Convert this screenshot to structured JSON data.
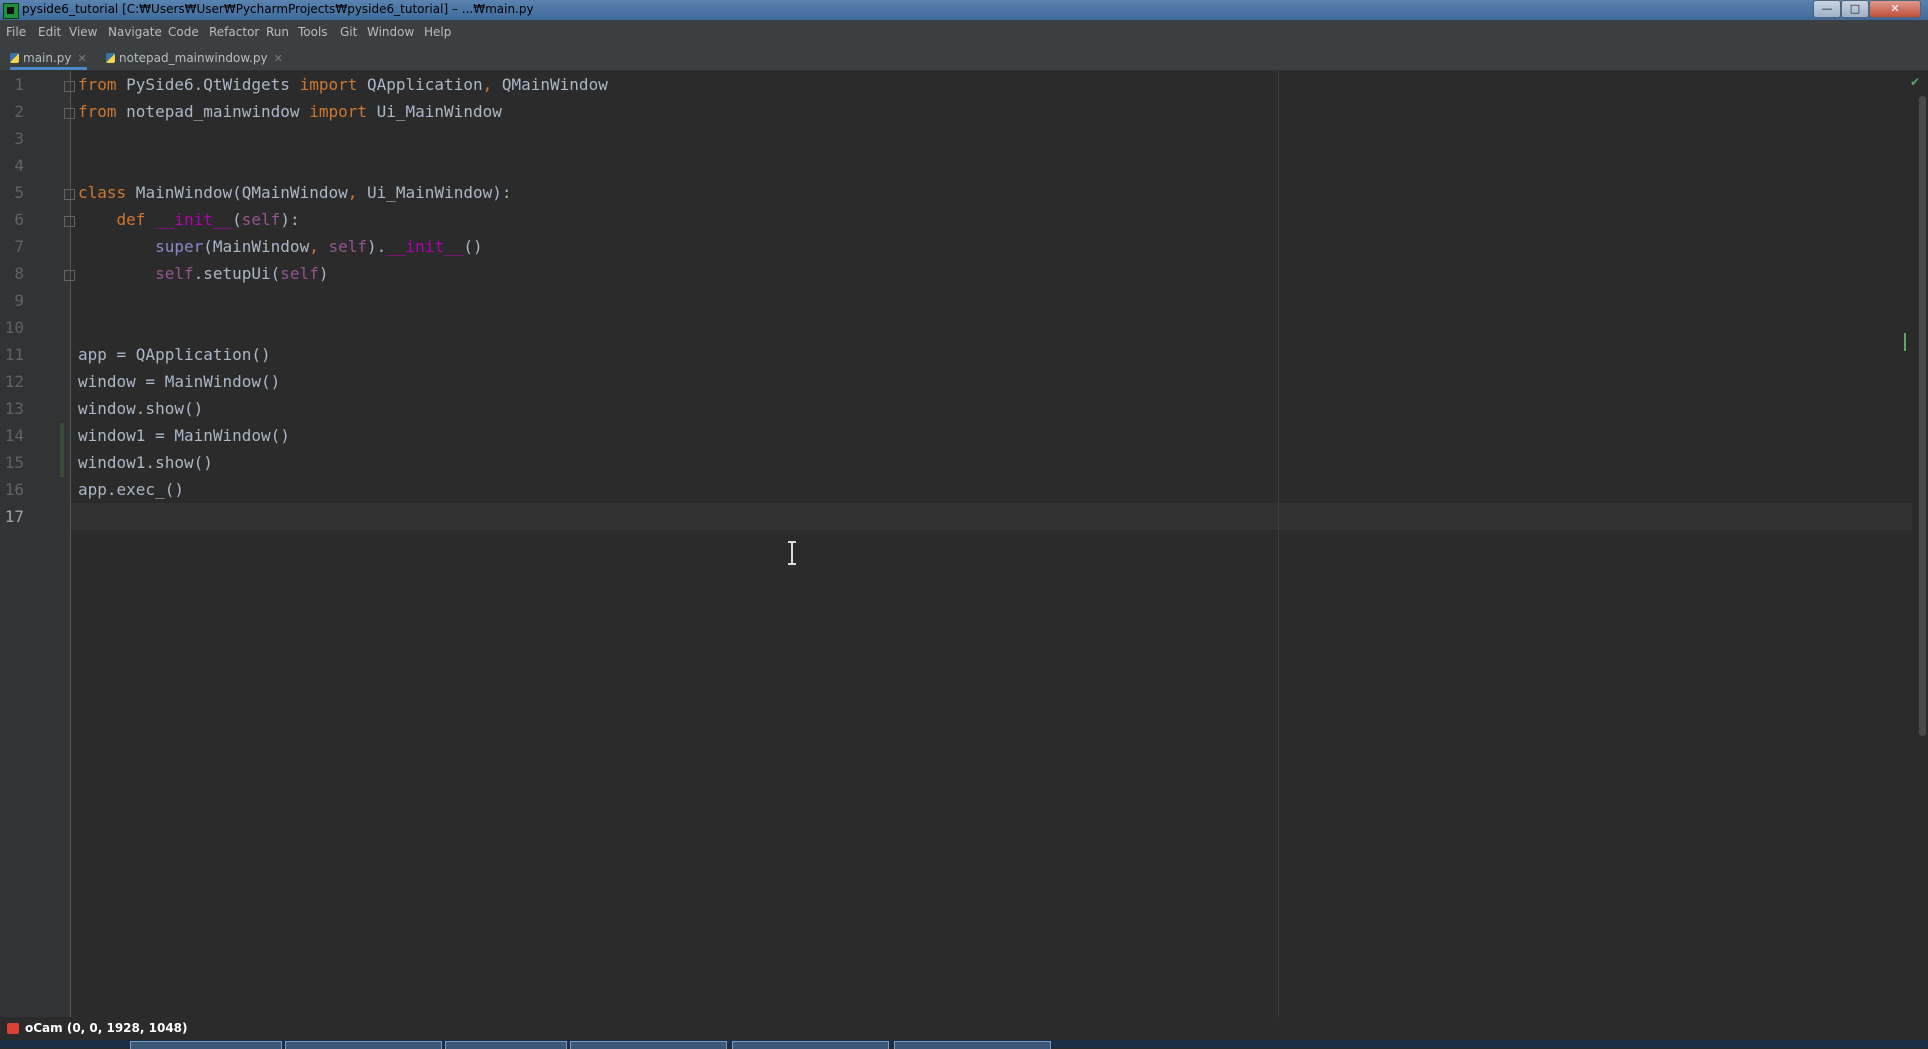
{
  "window": {
    "title": "pyside6_tutorial [C:₩Users₩User₩PycharmProjects₩pyside6_tutorial] – ...₩main.py",
    "controls": {
      "minimize": "—",
      "maximize": "□",
      "close": "✕"
    }
  },
  "menubar": {
    "items": [
      "File",
      "Edit",
      "View",
      "Navigate",
      "Code",
      "Refactor",
      "Run",
      "Tools",
      "Git",
      "Window",
      "Help"
    ]
  },
  "tabs": [
    {
      "label": "main.py",
      "active": true
    },
    {
      "label": "notepad_mainwindow.py",
      "active": false
    }
  ],
  "editor": {
    "line_numbers": [
      "1",
      "2",
      "3",
      "4",
      "5",
      "6",
      "7",
      "8",
      "9",
      "10",
      "11",
      "12",
      "13",
      "14",
      "15",
      "16",
      "17"
    ],
    "current_line": 17,
    "inspection_icon": "checkmark-icon",
    "lines": [
      "from PySide6.QtWidgets import QApplication, QMainWindow",
      "from notepad_mainwindow import Ui_MainWindow",
      "",
      "",
      "class MainWindow(QMainWindow, Ui_MainWindow):",
      "    def __init__(self):",
      "        super(MainWindow, self).__init__()",
      "        self.setupUi(self)",
      "",
      "",
      "app = QApplication()",
      "window = MainWindow()",
      "window.show()",
      "window1 = MainWindow()",
      "window1.show()",
      "app.exec_()",
      ""
    ]
  },
  "ocam": {
    "label": "oCam (0, 0, 1928, 1048)"
  },
  "colors": {
    "keyword": "#cc7832",
    "self": "#94558d",
    "magic": "#b200b2",
    "text": "#a9b7c6",
    "background": "#2b2b2b"
  }
}
